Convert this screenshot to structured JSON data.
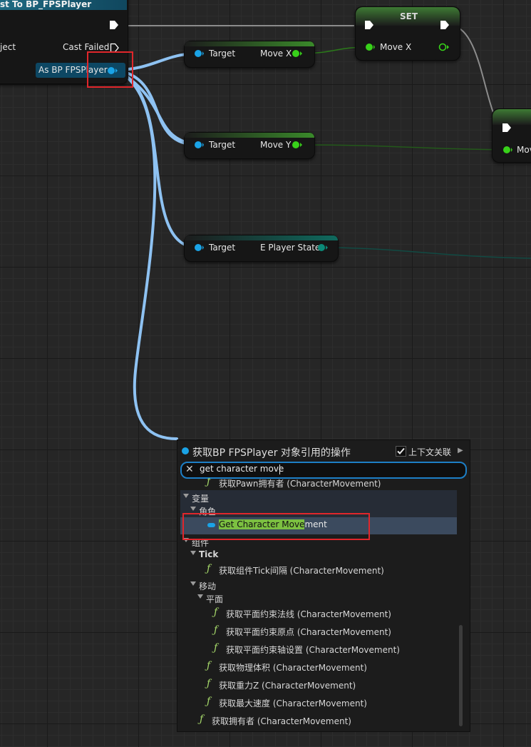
{
  "cast_node": {
    "title": "st To BP_FPSPlayer",
    "object_pin": "ject",
    "cast_failed": "Cast Failed",
    "as_pin": "As BP FPSPlayer"
  },
  "get_move_x": {
    "target": "Target",
    "output": "Move X"
  },
  "get_move_y": {
    "target": "Target",
    "output": "Move Y"
  },
  "get_player_state": {
    "target": "Target",
    "output": "E Player State"
  },
  "set_node": {
    "title": "SET",
    "input": "Move X"
  },
  "right_node": {
    "input": "Mov"
  },
  "popup": {
    "title": "获取BP FPSPlayer 对象引用的操作",
    "context_label": "上下文关联",
    "context_checked": true,
    "search_value": "get character move",
    "items": [
      {
        "text": "获取Pawn拥有者 (CharacterMovement)"
      },
      {
        "text": "变量"
      },
      {
        "text": "角色"
      },
      {
        "highlight": "Get Character Move",
        "rest": "ment"
      },
      {
        "text": "组件"
      },
      {
        "text": "Tick"
      },
      {
        "text": "获取组件Tick间隔 (CharacterMovement)"
      },
      {
        "text": "移动"
      },
      {
        "text": "平面"
      },
      {
        "text": "获取平面约束法线 (CharacterMovement)"
      },
      {
        "text": "获取平面约束原点 (CharacterMovement)"
      },
      {
        "text": "获取平面约束轴设置 (CharacterMovement)"
      },
      {
        "text": "获取物理体积 (CharacterMovement)"
      },
      {
        "text": "获取重力Z (CharacterMovement)"
      },
      {
        "text": "获取最大速度 (CharacterMovement)"
      },
      {
        "text": "获取拥有者 (CharacterMovement)"
      }
    ]
  },
  "icons": {
    "function": "function-icon",
    "variable": "variable-icon",
    "close": "close-icon",
    "check": "check-icon",
    "expand": "chevron-down-icon"
  },
  "colors": {
    "object_pin": "#1aa3e6",
    "float_pin": "#38d11a",
    "enum_pin": "#0b8a78",
    "highlight": "#7cc041",
    "annotation": "#e0262b"
  }
}
